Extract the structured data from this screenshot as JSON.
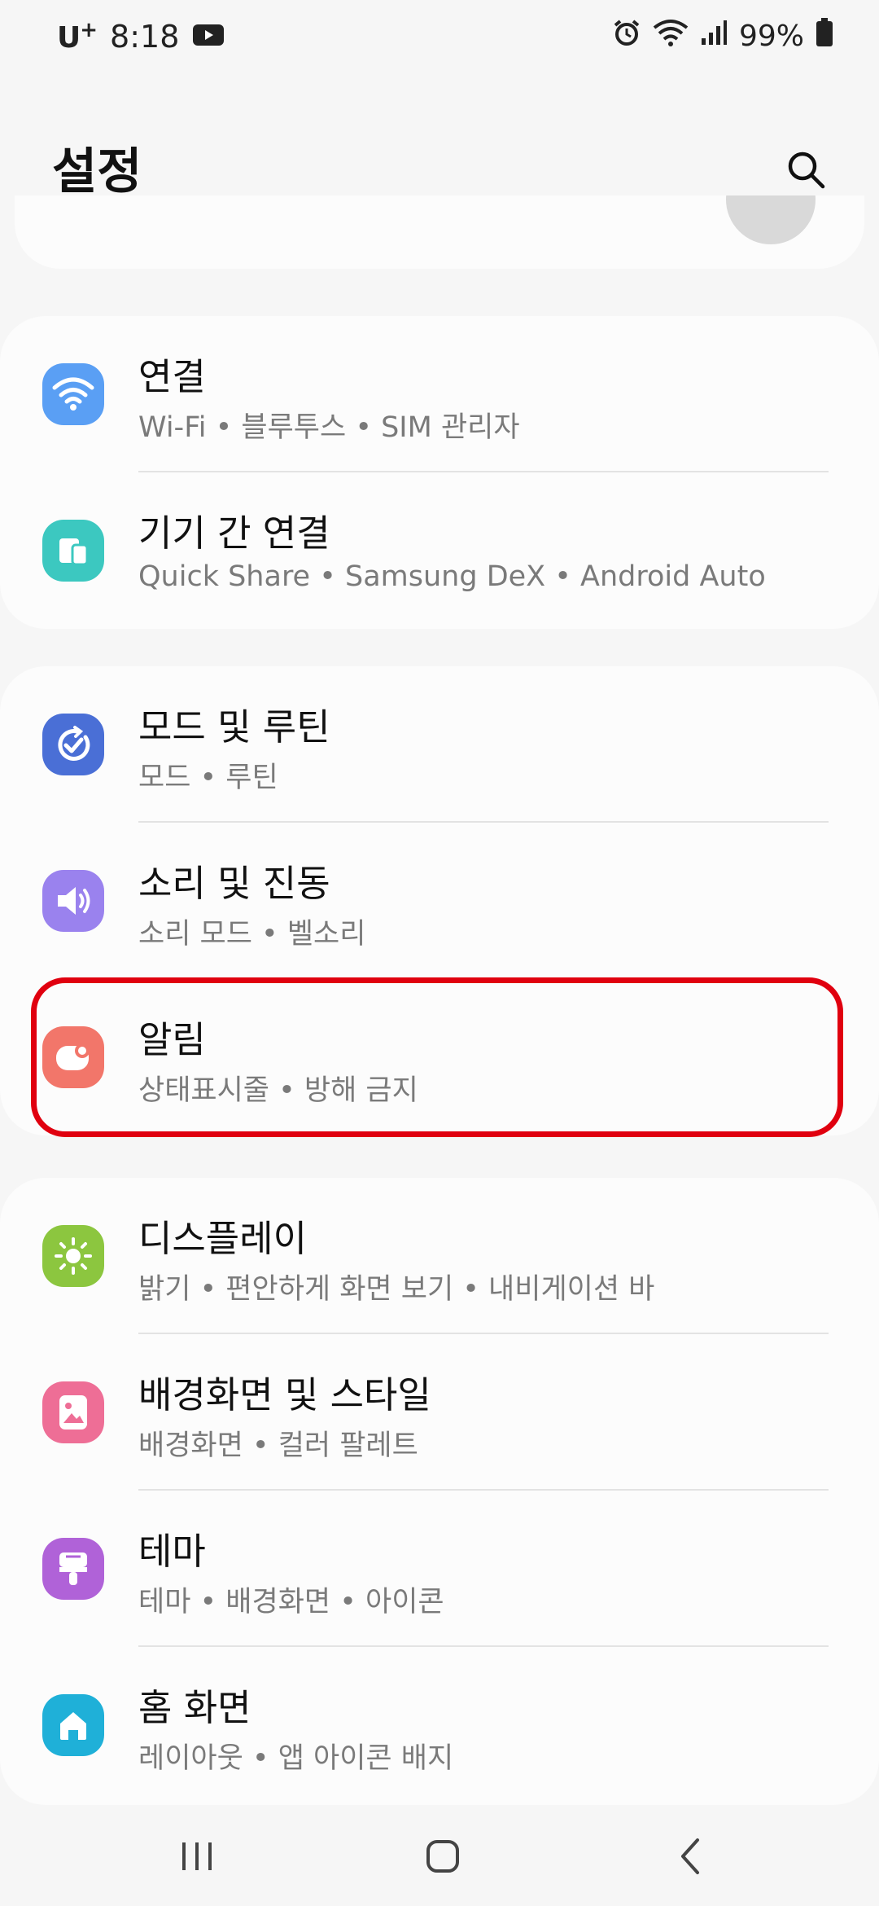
{
  "status_bar": {
    "carrier": "U",
    "carrier_sup": "+",
    "time": "8:18",
    "battery": "99%"
  },
  "header": {
    "title": "설정"
  },
  "groups": [
    {
      "items": [
        {
          "title": "연결",
          "subtitle": "Wi-Fi  •  블루투스  •  SIM 관리자",
          "icon": "wifi-icon",
          "color": "#5a9ff4"
        },
        {
          "title": "기기 간 연결",
          "subtitle": "Quick Share  •  Samsung DeX  •  Android Auto",
          "icon": "devices-icon",
          "color": "#3cc8c0"
        }
      ]
    },
    {
      "items": [
        {
          "title": "모드 및 루틴",
          "subtitle": "모드  •  루틴",
          "icon": "routine-icon",
          "color": "#4a6fd6"
        },
        {
          "title": "소리 및 진동",
          "subtitle": "소리 모드  •  벨소리",
          "icon": "speaker-icon",
          "color": "#9a82ee"
        },
        {
          "title": "알림",
          "subtitle": "상태표시줄  •  방해 금지",
          "icon": "notification-icon",
          "color": "#f2766a"
        }
      ]
    },
    {
      "items": [
        {
          "title": "디스플레이",
          "subtitle": "밝기  •  편안하게 화면 보기  •  내비게이션 바",
          "icon": "sun-icon",
          "color": "#8cc63f"
        },
        {
          "title": "배경화면 및 스타일",
          "subtitle": "배경화면  •  컬러 팔레트",
          "icon": "wallpaper-icon",
          "color": "#ee6e96"
        },
        {
          "title": "테마",
          "subtitle": "테마  •  배경화면  •  아이콘",
          "icon": "theme-brush-icon",
          "color": "#b062d8"
        },
        {
          "title": "홈 화면",
          "subtitle": "레이아웃  •  앱 아이콘 배지",
          "icon": "home-icon",
          "color": "#1fb0d8"
        }
      ]
    }
  ],
  "highlight_color": "#e0000f"
}
